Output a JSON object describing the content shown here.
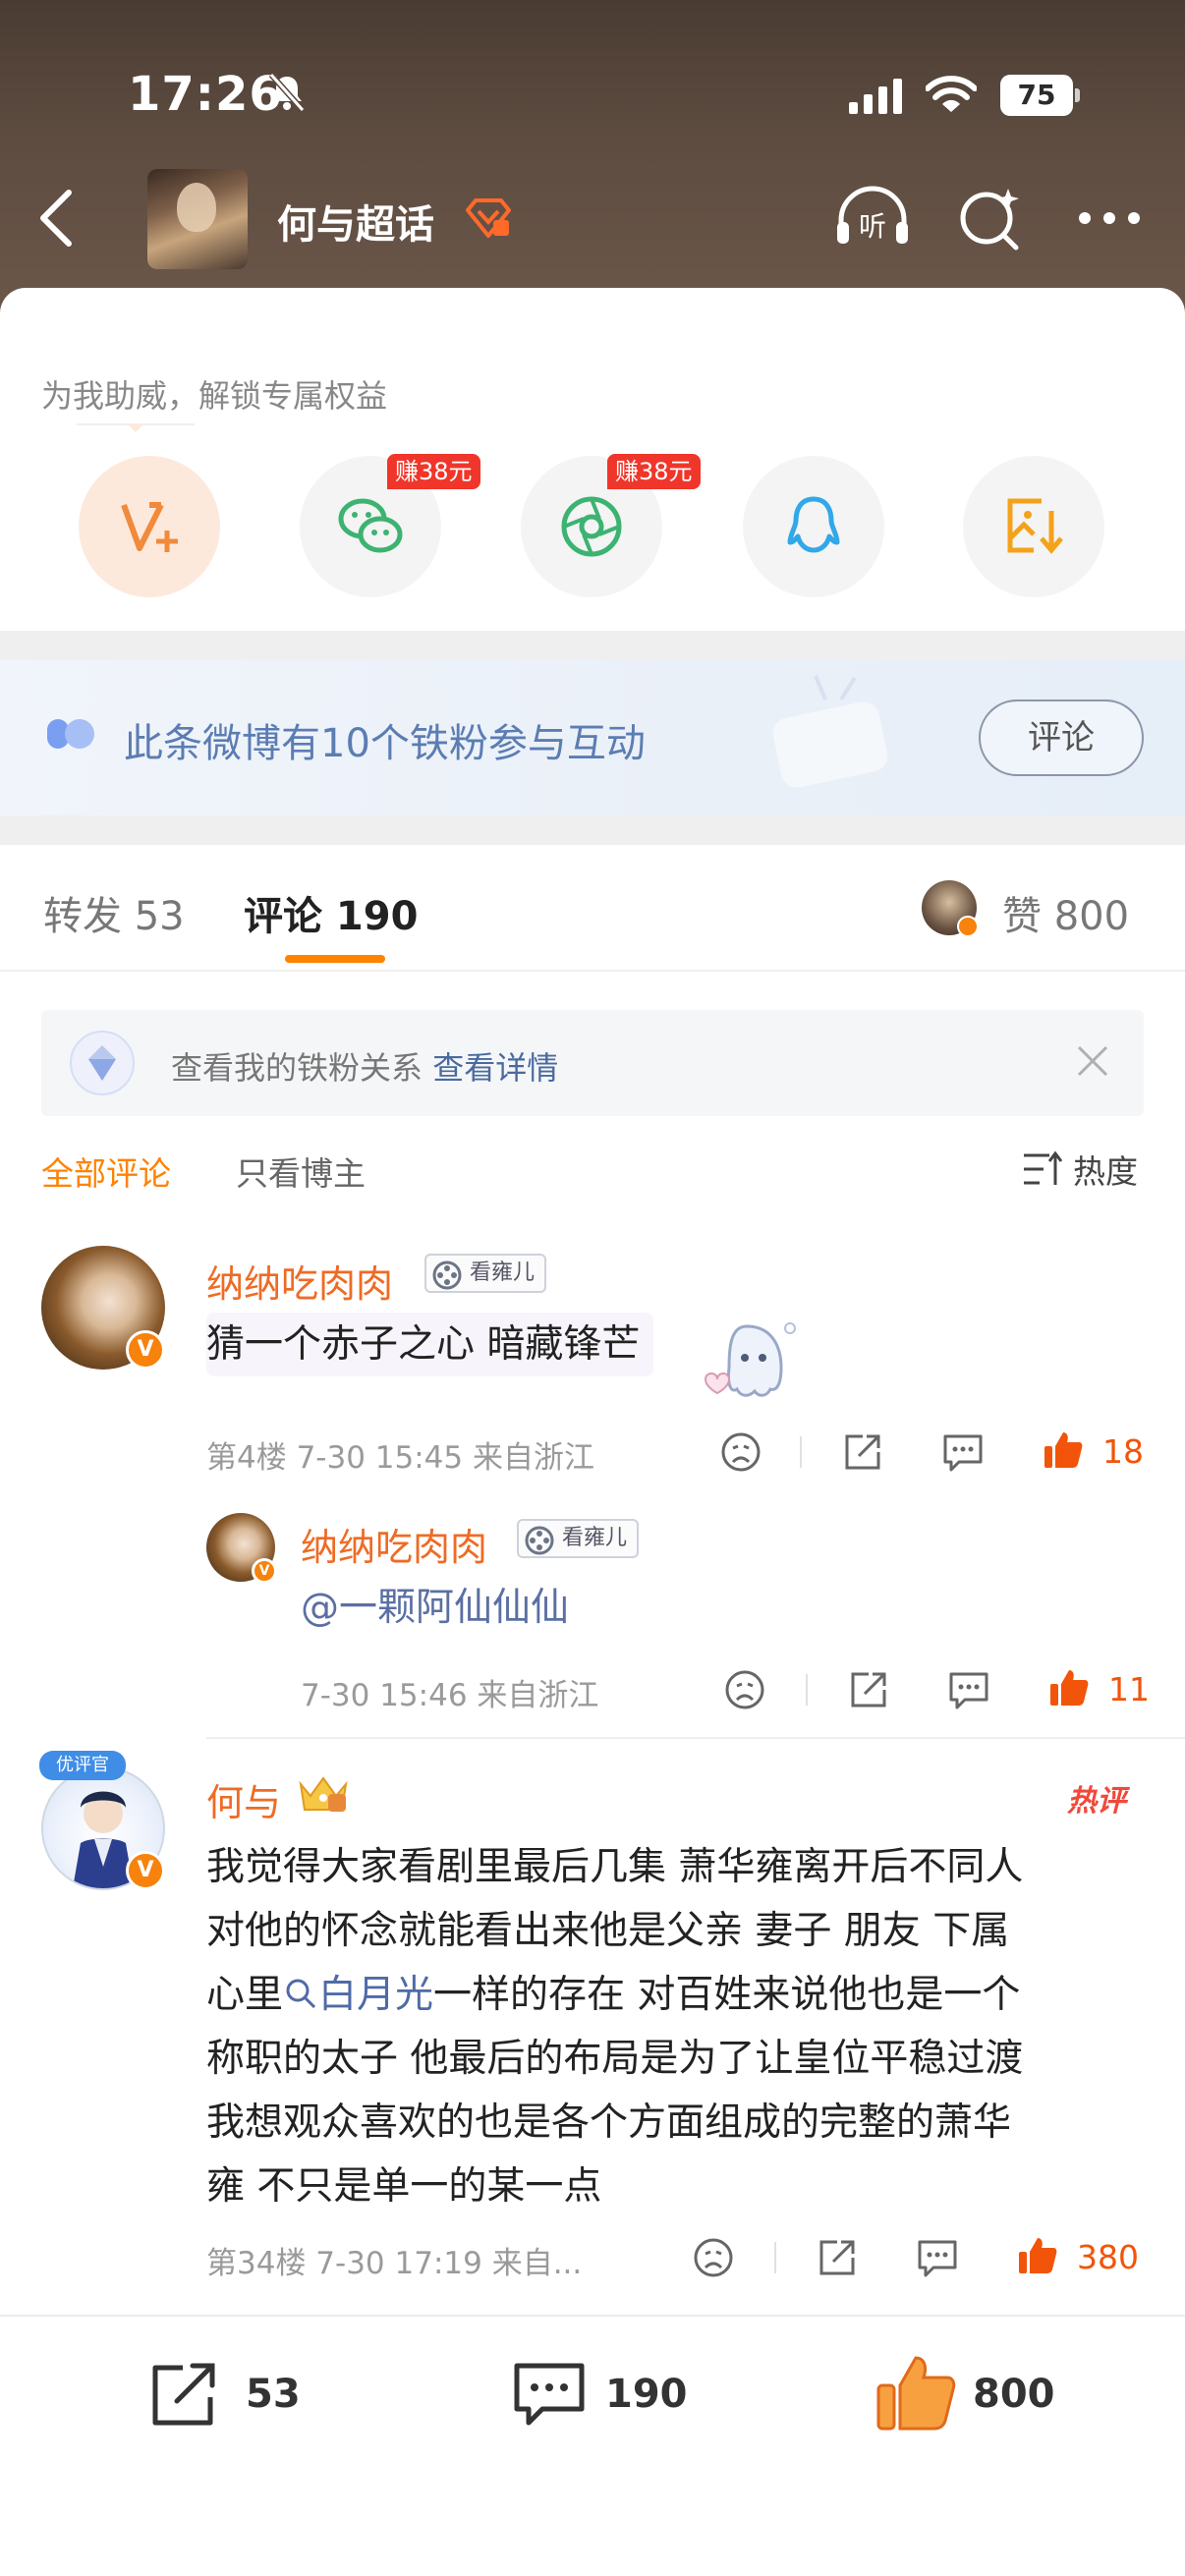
{
  "status_bar": {
    "time": "17:26",
    "battery": "75"
  },
  "header": {
    "title": "何与超话"
  },
  "boost": {
    "text": "为我助威，解锁专属权益",
    "earn_wechat": "赚38元",
    "earn_moments": "赚38元"
  },
  "fans_banner": {
    "text": "此条微博有10个铁粉参与互动",
    "button": "评论"
  },
  "tabs": {
    "repost": "转发 53",
    "comment": "评论 190",
    "like": "赞 800"
  },
  "fan_relation": {
    "text": "查看我的铁粉关系",
    "link": "查看详情"
  },
  "filter": {
    "all": "全部评论",
    "author": "只看博主",
    "sort": "热度"
  },
  "comments": [
    {
      "user": "纳纳吃肉肉",
      "badge": "看雍儿",
      "text": "猜一个赤子之心 暗藏锋芒",
      "meta": "第4楼 7-30 15:45 来自浙江",
      "likes": "18"
    },
    {
      "user": "何与",
      "you_tag": "优评官",
      "hot": "热评",
      "lines": [
        "我觉得大家看剧里最后几集 萧华雍离开后不同人",
        "对他的怀念就能看出来他是父亲 妻子 朋友 下属",
        "一样的存在 对百姓来说他也是一个",
        "称职的太子 他最后的布局是为了让皇位平稳过渡",
        "我想观众喜欢的也是各个方面组成的完整的萧华",
        "雍  不只是单一的某一点"
      ],
      "line3_prefix": "心里",
      "hashtag": "白月光",
      "meta": "第34楼 7-30 17:19 来自...",
      "likes": "380"
    }
  ],
  "reply": {
    "user": "纳纳吃肉肉",
    "badge": "看雍儿",
    "text": "@一颗阿仙仙仙",
    "meta": "7-30 15:46 来自浙江",
    "likes": "11"
  },
  "bottom_bar": {
    "repost": "53",
    "comment": "190",
    "like": "800"
  },
  "colors": {
    "accent": "#ff8200",
    "username": "#ef6b24",
    "like": "#f2540a",
    "link": "#4a6aa0"
  },
  "icons": [
    "back-icon",
    "listen-icon",
    "search-icon",
    "more-icon",
    "vplus-icon",
    "wechat-icon",
    "moments-icon",
    "qq-icon",
    "save-image-icon",
    "close-icon",
    "sort-icon",
    "dislike-icon",
    "share-icon",
    "comment-icon",
    "like-icon"
  ]
}
